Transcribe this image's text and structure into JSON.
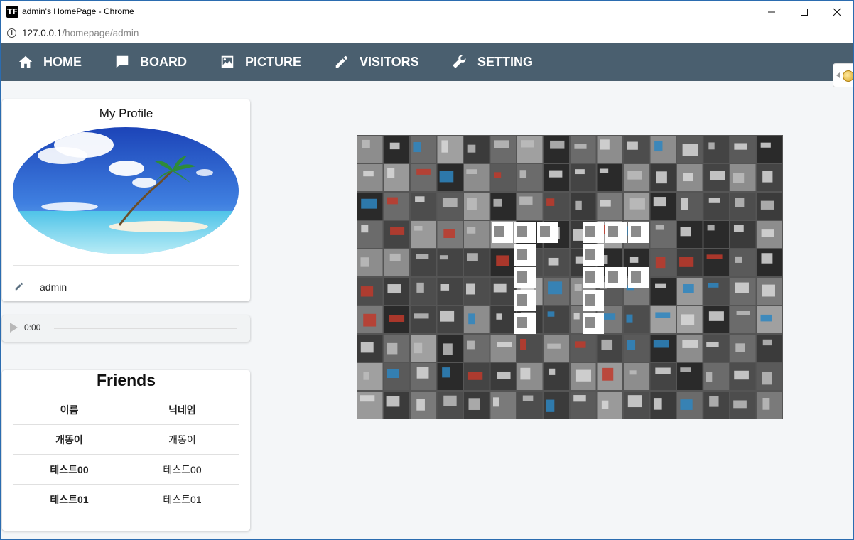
{
  "window": {
    "app_icon": "TF",
    "title": "admin's HomePage - Chrome",
    "minimize_icon": "minimize-icon",
    "maximize_icon": "maximize-icon",
    "close_icon": "close-icon"
  },
  "address": {
    "host": "127.0.0.1",
    "path": "/homepage/admin"
  },
  "nav": {
    "items": [
      {
        "label": "HOME",
        "icon": "home-icon"
      },
      {
        "label": "BOARD",
        "icon": "chat-icon"
      },
      {
        "label": "PICTURE",
        "icon": "picture-icon"
      },
      {
        "label": "VISITORS",
        "icon": "pencil-icon"
      },
      {
        "label": "SETTING",
        "icon": "wrench-icon"
      }
    ]
  },
  "profile": {
    "title": "My Profile",
    "name": "admin"
  },
  "audio": {
    "time": "0:00"
  },
  "friends": {
    "title": "Friends",
    "headers": [
      "이름",
      "닉네임"
    ],
    "rows": [
      {
        "name": "개똥이",
        "nickname": "개똥이"
      },
      {
        "name": "테스트00",
        "nickname": "테스트00"
      },
      {
        "name": "테스트01",
        "nickname": "테스트01"
      }
    ]
  },
  "colors": {
    "navbar": "#4a5f6f",
    "page_bg": "#f4f6f8",
    "window_border": "#2b6cb0"
  }
}
